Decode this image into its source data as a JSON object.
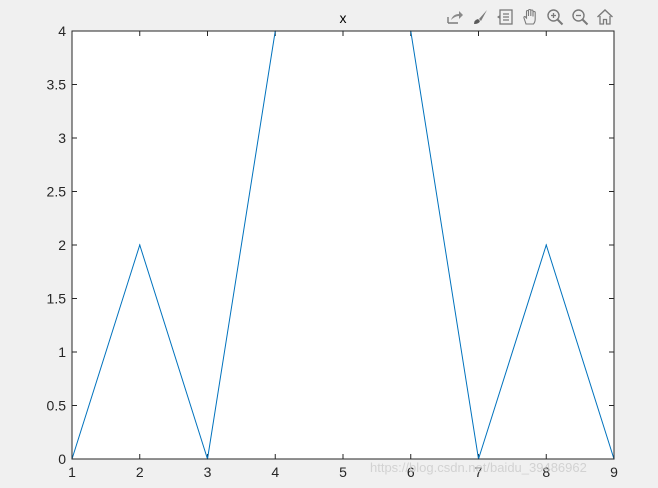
{
  "toolbar": {
    "buttons": [
      {
        "name": "export-icon"
      },
      {
        "name": "brush-icon"
      },
      {
        "name": "data-tips-icon"
      },
      {
        "name": "pan-hand-icon"
      },
      {
        "name": "zoom-in-icon"
      },
      {
        "name": "zoom-out-icon"
      },
      {
        "name": "home-icon"
      }
    ]
  },
  "watermark": "https://blog.csdn.net/baidu_39486962",
  "colors": {
    "line": "#0072bd",
    "axis": "#262626",
    "background": "#f0f0f0",
    "plot_area": "#ffffff"
  },
  "chart_data": {
    "type": "line",
    "title": "x",
    "xlabel": "",
    "ylabel": "",
    "xlim": [
      1,
      9
    ],
    "ylim": [
      0,
      4
    ],
    "xticks": [
      "1",
      "2",
      "3",
      "4",
      "5",
      "6",
      "7",
      "8",
      "9"
    ],
    "yticks": [
      "0",
      "0.5",
      "1",
      "1.5",
      "2",
      "2.5",
      "3",
      "3.5",
      "4"
    ],
    "grid": false,
    "series": [
      {
        "x": [
          1,
          2,
          3,
          4,
          5,
          6,
          7,
          8,
          9
        ],
        "values": [
          0,
          2,
          0,
          4,
          4,
          4,
          0,
          2,
          0
        ]
      }
    ]
  }
}
